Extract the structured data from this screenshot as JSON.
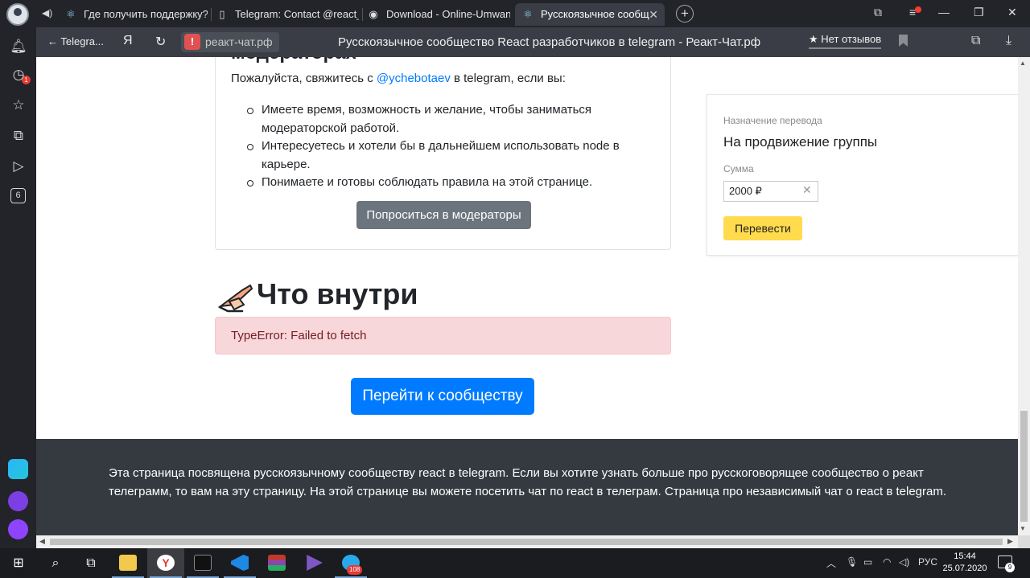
{
  "tabs": [
    {
      "label": "Где получить поддержку?",
      "icon": "react-icon"
    },
    {
      "label": "Telegram: Contact @react_",
      "icon": "page-icon"
    },
    {
      "label": "Download - Online-Umwan",
      "icon": "globe-icon"
    },
    {
      "label": "Русскоязычное сообщ",
      "icon": "react-icon",
      "active": true
    }
  ],
  "address_bar": {
    "back_label": "Telegra...",
    "yandex_label": "Я",
    "url": "реакт-чат.рф",
    "page_title": "Русскоязычное сообщество React разработчиков в telegram - Реакт-Чат.рф",
    "reviews_label": "★ Нет отзывов"
  },
  "sidebar": {
    "notification_count": "1",
    "tab_count": "6"
  },
  "moderators": {
    "heading": "модераторах",
    "intro_prefix": "Пожалуйста, свяжитесь с ",
    "contact": "@ychebotaev",
    "intro_suffix": " в telegram, если вы:",
    "items": [
      "Имеете время, возможность и желание, чтобы заниматься модераторской работой.",
      "Интересуетесь и хотели бы в дальнейшем использовать node в карьере.",
      "Понимаете и готовы соблюдать правила на этой странице."
    ],
    "button": "Попроситься в модераторы"
  },
  "inside": {
    "heading": "Что внутри",
    "error": "TypeError: Failed to fetch",
    "community_button": "Перейти к сообществу"
  },
  "transfer": {
    "purpose_label": "Назначение перевода",
    "purpose": "На продвижение группы",
    "amount_label": "Сумма",
    "amount": "2000 ₽",
    "button": "Перевести"
  },
  "footer": {
    "text": "Эта страница посвящена русскоязычному сообществу react в telegram. Если вы хотите узнать больше про русскоговорящее сообщество о реакт телеграмм, то вам на эту страницу. На этой странице вы можете посетить чат по react в телеграм. Страница про независимый чат о react в telegram."
  },
  "taskbar": {
    "telegram_badge": "108",
    "language": "РУС",
    "time": "15:44",
    "date": "25.07.2020",
    "notifications": "9"
  },
  "colors": {
    "primary": "#007bff",
    "secondary": "#6c757d",
    "alert_bg": "#f8d7da",
    "alert_text": "#721c24",
    "yandex_yellow": "#ffdb4d",
    "footer_bg": "#343a40"
  }
}
